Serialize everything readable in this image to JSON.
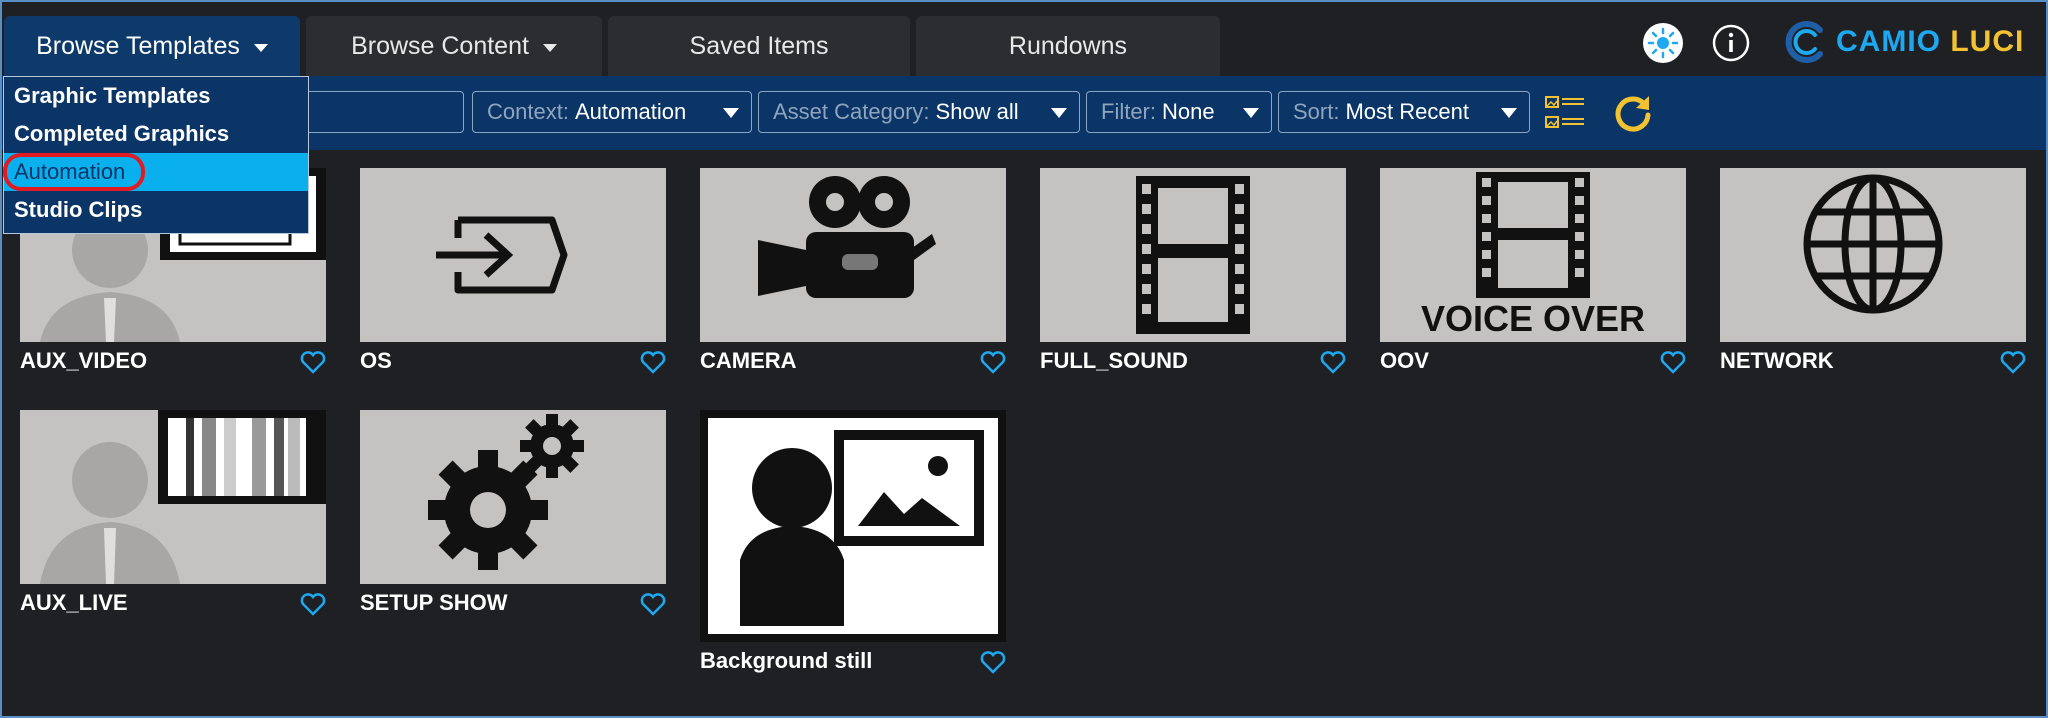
{
  "tabs": [
    {
      "label": "Browse Templates",
      "has_caret": true,
      "active": true
    },
    {
      "label": "Browse Content",
      "has_caret": true,
      "active": false
    },
    {
      "label": "Saved Items",
      "has_caret": false,
      "active": false
    },
    {
      "label": "Rundowns",
      "has_caret": false,
      "active": false
    }
  ],
  "header": {
    "theme_icon": "sun-icon",
    "info_icon": "info-icon",
    "brand_part1": "CAMIO",
    "brand_part2": "LUCI"
  },
  "dropdown_menu": {
    "items": [
      "Graphic Templates",
      "Completed Graphics",
      "Automation",
      "Studio Clips"
    ],
    "selected": "Automation"
  },
  "toolbar": {
    "search_value": "",
    "filters": [
      {
        "label": "Context:",
        "value": "Automation"
      },
      {
        "label": "Asset Category:",
        "value": "Show all"
      },
      {
        "label": "Filter:",
        "value": "None"
      },
      {
        "label": "Sort:",
        "value": "Most Recent"
      }
    ],
    "view_toggle_icon": "list-view-icon",
    "refresh_icon": "refresh-icon"
  },
  "items": [
    {
      "label": "AUX_VIDEO",
      "icon": "presenter-monitor-icon"
    },
    {
      "label": "OS",
      "icon": "input-icon"
    },
    {
      "label": "CAMERA",
      "icon": "camera-icon"
    },
    {
      "label": "FULL_SOUND",
      "icon": "film-strip-icon"
    },
    {
      "label": "OOV",
      "icon": "film-voice-over-icon",
      "thumb_text": "VOICE OVER"
    },
    {
      "label": "NETWORK",
      "icon": "globe-icon"
    },
    {
      "label": "AUX_LIVE",
      "icon": "presenter-color-bars-icon"
    },
    {
      "label": "SETUP SHOW",
      "icon": "gears-icon"
    },
    {
      "label": "Background still",
      "icon": "presenter-image-icon"
    }
  ],
  "colors": {
    "accent": "#1ea8f0",
    "brand_yellow": "#f2c230",
    "toolbar_bg": "#0a3566",
    "menu_selected": "#0ab0ee",
    "highlight_ring": "#e21b22"
  }
}
